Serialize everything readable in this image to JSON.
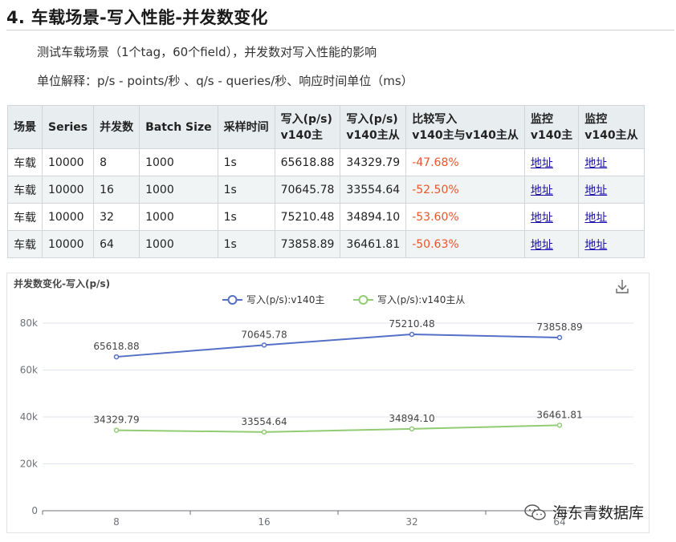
{
  "section": {
    "title": "4. 车载场景-写入性能-并发数变化",
    "desc": "测试车载场景（1个tag，60个field），并发数对写入性能的影响",
    "units": "单位解释：p/s - points/秒 、q/s - queries/秒、响应时间单位（ms）"
  },
  "table": {
    "headers": [
      "场景",
      "Series",
      "并发数",
      "Batch Size",
      "采样时间",
      "写入(p/s)\nv140主",
      "写入(p/s)\nv140主从",
      "比较写入\nv140主与v140主从",
      "监控\nv140主",
      "监控\nv140主从"
    ],
    "rows": [
      [
        "车载",
        "10000",
        "8",
        "1000",
        "1s",
        "65618.88",
        "34329.79",
        "-47.68%",
        "地址",
        "地址"
      ],
      [
        "车载",
        "10000",
        "16",
        "1000",
        "1s",
        "70645.78",
        "33554.64",
        "-52.50%",
        "地址",
        "地址"
      ],
      [
        "车载",
        "10000",
        "32",
        "1000",
        "1s",
        "75210.48",
        "34894.10",
        "-53.60%",
        "地址",
        "地址"
      ],
      [
        "车载",
        "10000",
        "64",
        "1000",
        "1s",
        "73858.89",
        "36461.81",
        "-50.63%",
        "地址",
        "地址"
      ]
    ],
    "colors": {
      "negative": "#e8552b",
      "link": "#1a0dab"
    }
  },
  "chart_data": {
    "type": "line",
    "title": "并发数变化-写入(p/s)",
    "categories": [
      "8",
      "16",
      "32",
      "64"
    ],
    "series": [
      {
        "name": "写入(p/s):v140主",
        "values": [
          65618.88,
          70645.78,
          75210.48,
          73858.89
        ],
        "labels": [
          "65618.88",
          "70645.78",
          "75210.48",
          "73858.89"
        ],
        "color": "#5470c6"
      },
      {
        "name": "写入(p/s):v140主从",
        "values": [
          34329.79,
          33554.64,
          34894.1,
          36461.81
        ],
        "labels": [
          "34329.79",
          "33554.64",
          "34894.10",
          "36461.81"
        ],
        "color": "#91cc75"
      }
    ],
    "ylim": [
      0,
      80000
    ],
    "yticks": [
      0,
      20000,
      40000,
      60000,
      80000
    ],
    "ytick_labels": [
      "0",
      "20k",
      "40k",
      "60k",
      "80k"
    ],
    "grid": true,
    "legend": "top-center",
    "download_icon": "download-icon"
  },
  "watermark": {
    "text": "海东青数据库",
    "icon": "wechat-icon"
  }
}
